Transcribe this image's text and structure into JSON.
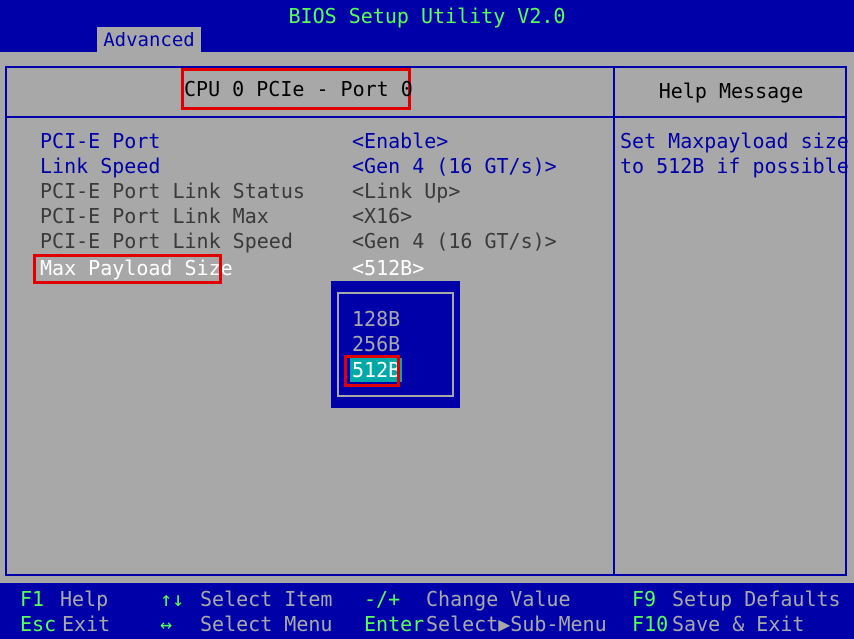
{
  "title": "BIOS Setup Utility V2.0",
  "tabs": [
    {
      "label": "Advanced",
      "active": true
    }
  ],
  "section_title": "CPU 0 PCIe - Port 0",
  "help": {
    "title": "Help Message",
    "lines": [
      "Set Maxpayload size",
      "to 512B if possible"
    ]
  },
  "settings": [
    {
      "label": "PCI-E Port",
      "value": "<Enable>",
      "editable": true
    },
    {
      "label": "Link Speed",
      "value": "<Gen 4 (16 GT/s)>",
      "editable": true
    },
    {
      "label": "PCI-E Port Link Status",
      "value": "<Link Up>",
      "editable": false
    },
    {
      "label": "PCI-E Port Link Max",
      "value": "<X16>",
      "editable": false
    },
    {
      "label": "PCI-E Port Link Speed",
      "value": "<Gen 4 (16 GT/s)>",
      "editable": false
    },
    {
      "label": "Max Payload Size",
      "value": "<512B>",
      "editable": true,
      "highlighted": true
    }
  ],
  "popup": {
    "options": [
      "128B",
      "256B",
      "512B"
    ],
    "selected": "512B"
  },
  "footer": {
    "row1": [
      {
        "key": "F1",
        "text": "Help"
      },
      {
        "key": "↑↓",
        "text": "Select Item"
      },
      {
        "key": "-/+",
        "text": "Change Value"
      },
      {
        "key": "F9",
        "text": "Setup Defaults"
      }
    ],
    "row2": [
      {
        "key": "Esc",
        "text": "Exit"
      },
      {
        "key": "↔",
        "text": "Select Menu"
      },
      {
        "key": "Enter",
        "text": "Select▶Sub-Menu"
      },
      {
        "key": "F10",
        "text": "Save & Exit"
      }
    ]
  },
  "colors": {
    "background": "#0000a8",
    "panel": "#a8a8a8",
    "title_text": "#55ff55",
    "highlight_box": "#e00000",
    "popup_selected": "#00a8a8"
  }
}
